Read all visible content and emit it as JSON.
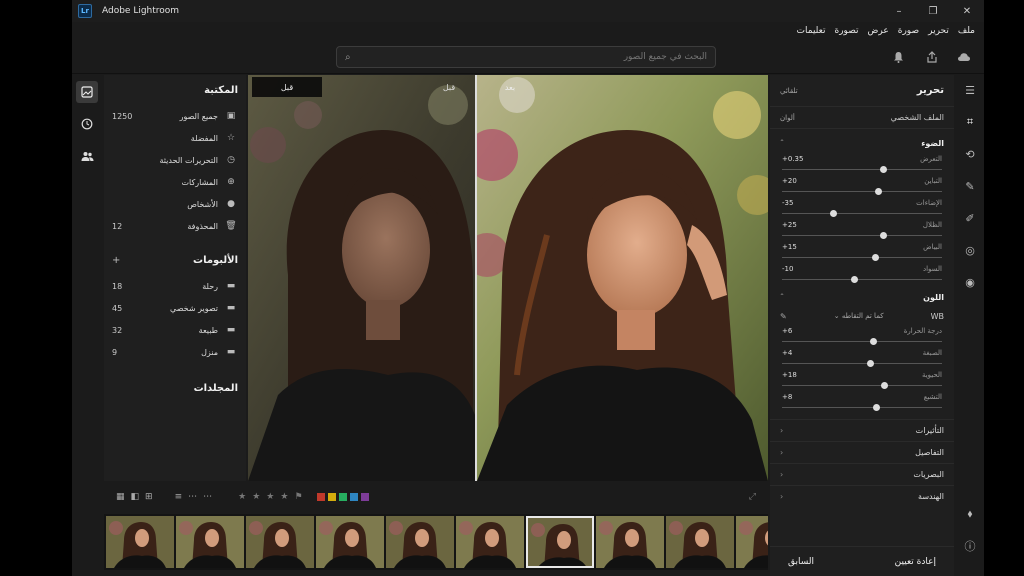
{
  "window": {
    "title": "Adobe Lightroom",
    "logo": "Lr",
    "controls": [
      "–",
      "❐",
      "✕"
    ]
  },
  "menu": [
    "ملف",
    "تحرير",
    "صورة",
    "عرض",
    "تصورة",
    "تعليمات"
  ],
  "search": {
    "placeholder": "البحث في جميع الصور"
  },
  "library": {
    "title": "المكتبة",
    "items": [
      {
        "label": "جميع الصور",
        "count": "1250",
        "icon": "photos-icon"
      },
      {
        "label": "المفضلة",
        "count": "",
        "icon": "star-icon"
      },
      {
        "label": "التحريرات الحديثة",
        "count": "",
        "icon": "history-icon"
      },
      {
        "label": "المشاركات",
        "count": "",
        "icon": "share-icon"
      },
      {
        "label": "الأشخاص",
        "count": "",
        "icon": "person-icon"
      },
      {
        "label": "المحذوفة",
        "count": "12",
        "icon": "trash-icon"
      }
    ],
    "albums_title": "الألبومات",
    "albums": [
      {
        "label": "رحلة",
        "count": "18"
      },
      {
        "label": "تصوير شخصي",
        "count": "45"
      },
      {
        "label": "طبيعة",
        "count": "32"
      },
      {
        "label": "منزل",
        "count": "9"
      }
    ],
    "folders_title": "المجلدات"
  },
  "viewer": {
    "before_label": "قبل",
    "before_label2": "قبل",
    "after_label": "بعد"
  },
  "edit": {
    "title": "تحرير",
    "auto_label": "تلقائي",
    "profile_label": "الملف الشخصي",
    "profile_value": "ألوان",
    "light_title": "الضوء",
    "light": [
      {
        "label": "التعرض",
        "value": "+0.35",
        "pos": 0.63
      },
      {
        "label": "التباين",
        "value": "+20",
        "pos": 0.6
      },
      {
        "label": "الإضاءات",
        "value": "-35",
        "pos": 0.32
      },
      {
        "label": "الظلال",
        "value": "+25",
        "pos": 0.63
      },
      {
        "label": "البياض",
        "value": "+15",
        "pos": 0.58
      },
      {
        "label": "السواد",
        "value": "-10",
        "pos": 0.45
      }
    ],
    "color_title": "اللون",
    "wb_label": "WB",
    "wb_value": "كما تم التقاطه",
    "color": [
      {
        "label": "درجة الحرارة",
        "value": "+6",
        "pos": 0.57
      },
      {
        "label": "الصبغة",
        "value": "+4",
        "pos": 0.55
      },
      {
        "label": "الحيوية",
        "value": "+18",
        "pos": 0.64
      },
      {
        "label": "التشبع",
        "value": "+8",
        "pos": 0.59
      }
    ],
    "sections": [
      "التأثيرات",
      "التفاصيل",
      "البصريات",
      "الهندسة"
    ],
    "reset_label": "إعادة تعيين",
    "previous_label": "السابق"
  },
  "filmstrip": {
    "count": 10,
    "selected": 6
  },
  "colors": {
    "accent": "#e8e8e8",
    "label_colors": [
      "#c0392b",
      "#d4ac0d",
      "#27ae60",
      "#2e86c1",
      "#7d3c98"
    ]
  }
}
